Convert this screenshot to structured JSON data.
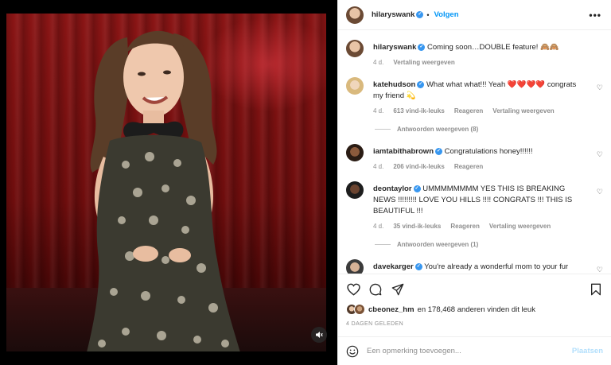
{
  "post": {
    "author": "hilaryswank",
    "follow_label": "Volgen",
    "more_label": "•••"
  },
  "comments": [
    {
      "user": "hilaryswank",
      "text": "Coming soon…DOUBLE feature! 🙈🙈",
      "age": "4 d.",
      "translate": "Vertaling weergeven"
    },
    {
      "user": "katehudson",
      "text": "What what what!!! Yeah ❤️❤️❤️❤️ congrats my friend 💫",
      "age": "4 d.",
      "likes": "613 vind-ik-leuks",
      "reply": "Reageren",
      "translate": "Vertaling weergeven",
      "replies": "Antwoorden weergeven (8)"
    },
    {
      "user": "iamtabithabrown",
      "text": "Congratulations honey!!!!!!",
      "age": "4 d.",
      "likes": "206 vind-ik-leuks",
      "reply": "Reageren"
    },
    {
      "user": "deontaylor",
      "text": "UMMMMMMMM YES THIS IS BREAKING NEWS !!!!!!!!! LOVE YOU HILLS !!!! CONGRATS !!! THIS IS BEAUTIFUL !!!",
      "age": "4 d.",
      "likes": "35 vind-ik-leuks",
      "reply": "Reageren",
      "translate": "Vertaling weergeven",
      "replies": "Antwoorden weergeven (1)"
    },
    {
      "user": "davekarger",
      "text": "You're already a wonderful mom to your fur babies…this is the best next chapter! ❤️"
    }
  ],
  "likes_line": {
    "user": "cbeonez_hm",
    "rest": "en 178,468 anderen vinden dit leuk"
  },
  "date": "4 DAGEN GELEDEN",
  "add_comment": {
    "placeholder": "Een opmerking toevoegen...",
    "post_label": "Plaatsen"
  },
  "icons": {
    "like": "heart-icon",
    "comment": "comment-icon",
    "share": "paper-plane-icon",
    "save": "bookmark-icon",
    "emoji": "smiley-icon",
    "sound": "speaker-icon",
    "verified": "verified-badge-icon"
  },
  "colors": {
    "link_blue": "#0095f6",
    "verified_blue": "#3897f0",
    "heart_red": "#ed4956",
    "post_btn_disabled": "#b2dffc"
  }
}
